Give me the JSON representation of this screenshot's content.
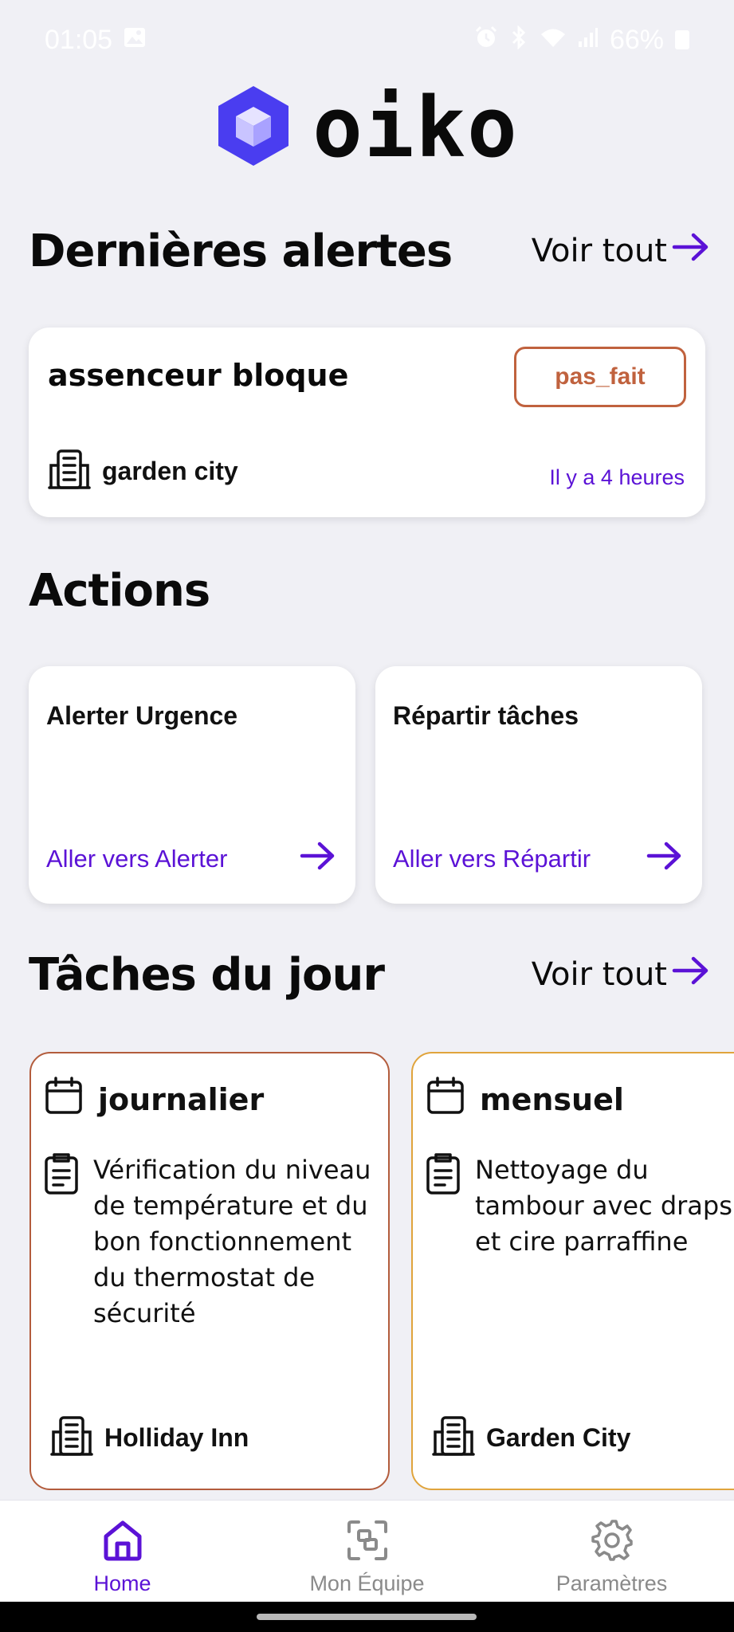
{
  "status_bar": {
    "time": "01:05",
    "battery": "66%",
    "icons": [
      "image-icon",
      "alarm-icon",
      "bluetooth-icon",
      "wifi-icon",
      "signal-icon",
      "battery-icon"
    ]
  },
  "logo": {
    "text": "oiko",
    "icon": "cube-hexagon-icon",
    "color": "#4a3df0"
  },
  "alerts_section": {
    "title": "Dernières alertes",
    "see_all": "Voir tout",
    "alert": {
      "title": "assenceur bloque",
      "status": "pas_fait",
      "building": "garden city",
      "time": "Il y a 4 heures"
    }
  },
  "actions_section": {
    "title": "Actions",
    "cards": [
      {
        "title": "Alerter Urgence",
        "link": "Aller vers Alerter"
      },
      {
        "title": "Répartir tâches",
        "link": "Aller vers Répartir"
      }
    ]
  },
  "tasks_section": {
    "title": "Tâches du jour",
    "see_all": "Voir tout",
    "tasks": [
      {
        "frequency": "journalier",
        "description": "Vérification du niveau de température et du bon fonctionnement du thermostat de sécurité",
        "building": "Holliday Inn",
        "border_color": "#b35c3c"
      },
      {
        "frequency": "mensuel",
        "description": "Nettoyage du tambour avec draps et cire parraffine",
        "building": "Garden City",
        "border_color": "#e0a43c"
      }
    ]
  },
  "bottom_nav": {
    "items": [
      {
        "label": "Home",
        "icon": "home-icon",
        "active": true
      },
      {
        "label": "Mon Équipe",
        "icon": "team-scan-icon",
        "active": false
      },
      {
        "label": "Paramètres",
        "icon": "gear-icon",
        "active": false
      }
    ]
  },
  "colors": {
    "accent": "#5b12d6",
    "badge": "#c0623e",
    "background": "#f0f0f5"
  }
}
